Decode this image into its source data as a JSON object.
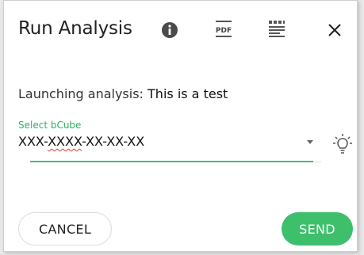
{
  "dialog": {
    "title": "Run Analysis",
    "icons": {
      "info": "info-icon",
      "pdf": "pdf-icon",
      "pdf_text": "PDF",
      "list": "list-icon",
      "close": "close-icon"
    }
  },
  "status": {
    "prefix": "Launching analysis: ",
    "analysis_name": "This is a test"
  },
  "bcube_field": {
    "label": "Select bCube",
    "value_before": "XXX-",
    "value_misspelled": "XXXX",
    "value_after": "-XX-XX-XX"
  },
  "buttons": {
    "cancel": "CANCEL",
    "send": "SEND"
  },
  "colors": {
    "accent": "#3dbf6c",
    "label": "#2ab45f",
    "spellcheck": "#e53935"
  }
}
